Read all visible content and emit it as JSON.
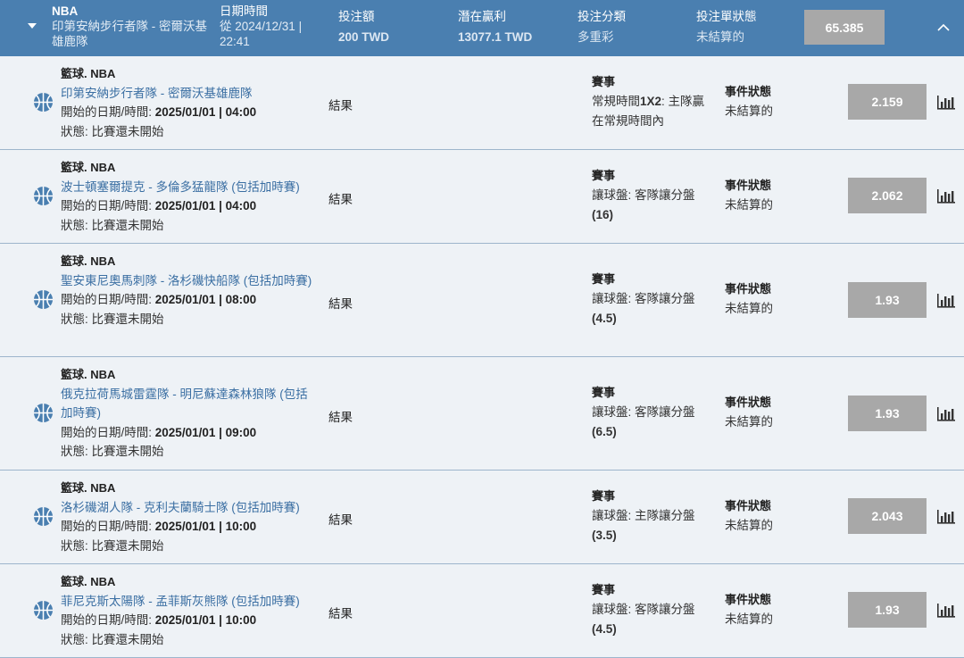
{
  "colors": {
    "header_bg": "#4a7fb0",
    "odds_bg": "#a8a8a8",
    "link": "#3b6fa3",
    "divider": "#9db5cc"
  },
  "header": {
    "league": "NBA",
    "match": "印第安納步行者隊 - 密爾沃基雄鹿隊",
    "date_label": "日期時間",
    "date_value": "從 2024/12/31 | 22:41",
    "stake_label": "投注額",
    "stake_value": "200 TWD",
    "potential_label": "潛在贏利",
    "potential_value": "13077.1 TWD",
    "type_label": "投注分類",
    "type_value": "多重彩",
    "status_label": "投注單狀態",
    "status_value": "未結算的",
    "total_odds": "65.385",
    "expand_icon": "caret-down-icon",
    "collapse_icon": "chevron-up-icon"
  },
  "labels": {
    "start_prefix": "開始的日期/時間:",
    "status_text": "狀態: 比賽還未開始",
    "result": "結果",
    "market": "賽事",
    "event_status": "事件狀態",
    "event_status_value": "未結算的",
    "sport_icon": "basketball-icon",
    "stats_icon": "bar-chart-icon"
  },
  "selections": [
    {
      "league": "籃球. NBA",
      "match": "印第安納步行者隊 - 密爾沃基雄鹿隊",
      "start": "2025/01/01 | 04:00",
      "market_pre": "常規時間",
      "market_bold": "1X2",
      "market_post": ": 主隊贏在常規時間內",
      "market_paren": "",
      "odds": "2.159"
    },
    {
      "league": "籃球. NBA",
      "match": "波士頓塞爾提克 - 多倫多猛龍隊 (包括加時賽)",
      "start": "2025/01/01 | 04:00",
      "market_pre": "讓球盤: 客隊讓分盤",
      "market_bold": "",
      "market_post": "",
      "market_paren": "(16)",
      "odds": "2.062"
    },
    {
      "league": "籃球. NBA",
      "match": "聖安東尼奧馬刺隊 - 洛杉磯快船隊 (包括加時賽)",
      "start": "2025/01/01 | 08:00",
      "market_pre": "讓球盤: 客隊讓分盤",
      "market_bold": "",
      "market_post": "",
      "market_paren": "(4.5)",
      "odds": "1.93"
    },
    {
      "league": "籃球. NBA",
      "match": "俄克拉荷馬城雷霆隊 - 明尼蘇達森林狼隊 (包括加時賽)",
      "start": "2025/01/01 | 09:00",
      "market_pre": "讓球盤: 客隊讓分盤",
      "market_bold": "",
      "market_post": "",
      "market_paren": "(6.5)",
      "odds": "1.93"
    },
    {
      "league": "籃球. NBA",
      "match": "洛杉磯湖人隊 - 克利夫蘭騎士隊 (包括加時賽)",
      "start": "2025/01/01 | 10:00",
      "market_pre": "讓球盤: 主隊讓分盤",
      "market_bold": "",
      "market_post": "",
      "market_paren": "(3.5)",
      "odds": "2.043"
    },
    {
      "league": "籃球. NBA",
      "match": "菲尼克斯太陽隊 - 孟菲斯灰熊隊 (包括加時賽)",
      "start": "2025/01/01 | 10:00",
      "market_pre": "讓球盤: 客隊讓分盤",
      "market_bold": "",
      "market_post": "",
      "market_paren": "(4.5)",
      "odds": "1.93"
    }
  ]
}
